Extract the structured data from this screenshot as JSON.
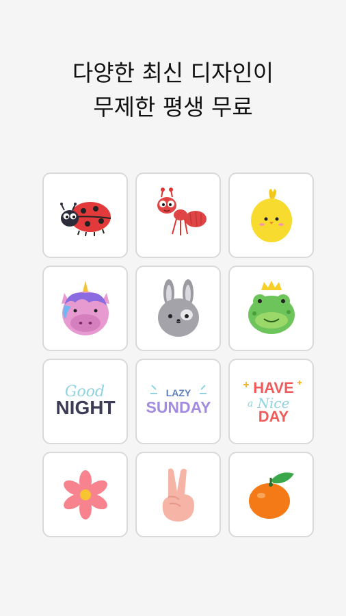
{
  "headline": {
    "line1": "다양한 최신 디자인이",
    "line2": "무제한 평생 무료"
  },
  "stickers": [
    {
      "name": "ladybug",
      "label": ""
    },
    {
      "name": "ant",
      "label": ""
    },
    {
      "name": "chick",
      "label": ""
    },
    {
      "name": "unicorn",
      "label": ""
    },
    {
      "name": "bunny",
      "label": ""
    },
    {
      "name": "frog-prince",
      "label": ""
    },
    {
      "name": "good-night",
      "text_top": "Good",
      "text_bottom": "NIGHT"
    },
    {
      "name": "lazy-sunday",
      "text_top": "LAZY",
      "text_bottom": "SUNDAY"
    },
    {
      "name": "have-a-nice-day",
      "text_top": "HAVE",
      "text_mid_a": "a",
      "text_mid": "Nice",
      "text_bottom": "DAY"
    },
    {
      "name": "flower",
      "label": ""
    },
    {
      "name": "victory-hand",
      "label": ""
    },
    {
      "name": "tangerine",
      "label": ""
    }
  ],
  "colors": {
    "background": "#f5f5f5",
    "tile_border": "#d9d9d9",
    "ladybug_red": "#e23a3a",
    "chick_yellow": "#f7dc2f",
    "unicorn_pink": "#e79ad0",
    "bunny_gray": "#9a9aa0",
    "frog_green": "#6cc45a",
    "night_blue": "#8fd3e0",
    "sunday_purple": "#a28be0",
    "nice_day_red": "#f05a5a",
    "flower_pink": "#f7838f",
    "hand_skin": "#f6b4a6",
    "tangerine_orange": "#f47a18"
  }
}
